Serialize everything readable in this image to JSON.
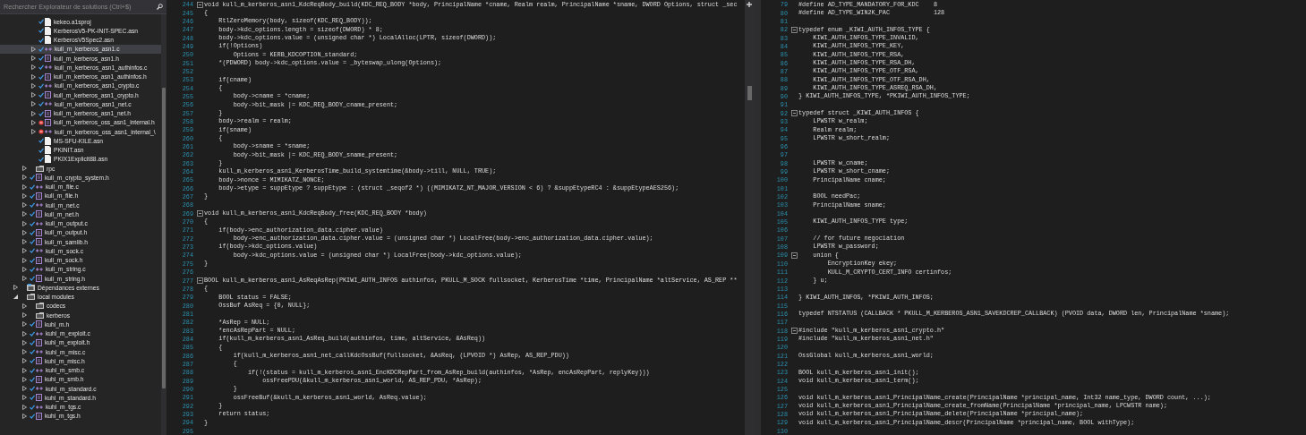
{
  "solution_explorer": {
    "search": {
      "placeholder": "Rechercher Explorateur de solutions (Ctrl+$)"
    },
    "tree": [
      {
        "children": [
          {
            "children": [
              {
                "label": "kekeo.a1sproj",
                "kind": "project",
                "checked": true,
                "error": false,
                "selected": false
              },
              {
                "label": "KerberosV5-PK-INIT-SPEC.asn",
                "kind": "asn",
                "checked": true,
                "error": false,
                "selected": false
              },
              {
                "label": "KerberosV5Spec2.asn",
                "kind": "asn",
                "checked": true,
                "error": false,
                "selected": false
              },
              {
                "label": "kull_m_kerberos_asn1.c",
                "kind": "c",
                "checked": true,
                "error": false,
                "expanded": false,
                "selected": true
              },
              {
                "label": "kull_m_kerberos_asn1.h",
                "kind": "h",
                "checked": true,
                "error": false,
                "expanded": false,
                "selected": false
              },
              {
                "label": "kull_m_kerberos_asn1_authinfos.c",
                "kind": "c",
                "checked": true,
                "error": false,
                "expanded": false,
                "selected": false
              },
              {
                "label": "kull_m_kerberos_asn1_authinfos.h",
                "kind": "h",
                "checked": true,
                "error": false,
                "expanded": false,
                "selected": false
              },
              {
                "label": "kull_m_kerberos_asn1_crypto.c",
                "kind": "c",
                "checked": true,
                "error": false,
                "expanded": false,
                "selected": false
              },
              {
                "label": "kull_m_kerberos_asn1_crypto.h",
                "kind": "h",
                "checked": true,
                "error": false,
                "expanded": false,
                "selected": false
              },
              {
                "label": "kull_m_kerberos_asn1_net.c",
                "kind": "c",
                "checked": true,
                "error": false,
                "expanded": false,
                "selected": false
              },
              {
                "label": "kull_m_kerberos_asn1_net.h",
                "kind": "h",
                "checked": true,
                "error": false,
                "expanded": false,
                "selected": false
              },
              {
                "label": "kull_m_kerberos_oss_asn1_internal.h",
                "kind": "h",
                "checked": false,
                "error": true,
                "expanded": false,
                "selected": false
              },
              {
                "label": "kull_m_kerberos_oss_asn1_internal_\\",
                "kind": "c",
                "checked": false,
                "error": true,
                "expanded": false,
                "selected": false
              },
              {
                "label": "MS-SFU-KILE.asn",
                "kind": "asn",
                "checked": true,
                "error": false,
                "selected": false
              },
              {
                "label": "PKINIT.asn",
                "kind": "asn",
                "checked": true,
                "error": false,
                "selected": false
              },
              {
                "label": "PKIX1Explicit88.asn",
                "kind": "asn",
                "checked": true,
                "error": false,
                "selected": false
              }
            ]
          },
          {
            "label": "rpc",
            "kind": "folder",
            "checked": false,
            "error": false,
            "expanded": false,
            "selected": false
          },
          {
            "label": "kull_m_crypto_system.h",
            "kind": "h",
            "checked": true,
            "error": false,
            "expanded": false,
            "selected": false
          },
          {
            "label": "kull_m_file.c",
            "kind": "c",
            "checked": true,
            "error": false,
            "expanded": false,
            "selected": false
          },
          {
            "label": "kull_m_file.h",
            "kind": "h",
            "checked": true,
            "error": false,
            "expanded": false,
            "selected": false
          },
          {
            "label": "kull_m_net.c",
            "kind": "c",
            "checked": true,
            "error": false,
            "expanded": false,
            "selected": false
          },
          {
            "label": "kull_m_net.h",
            "kind": "h",
            "checked": true,
            "error": false,
            "expanded": false,
            "selected": false
          },
          {
            "label": "kull_m_output.c",
            "kind": "c",
            "checked": true,
            "error": false,
            "expanded": false,
            "selected": false
          },
          {
            "label": "kull_m_output.h",
            "kind": "h",
            "checked": true,
            "error": false,
            "expanded": false,
            "selected": false
          },
          {
            "label": "kull_m_samlib.h",
            "kind": "h",
            "checked": true,
            "error": false,
            "expanded": false,
            "selected": false
          },
          {
            "label": "kull_m_sock.c",
            "kind": "c",
            "checked": true,
            "error": false,
            "expanded": false,
            "selected": false
          },
          {
            "label": "kull_m_sock.h",
            "kind": "h",
            "checked": true,
            "error": false,
            "expanded": false,
            "selected": false
          },
          {
            "label": "kull_m_string.c",
            "kind": "c",
            "checked": true,
            "error": false,
            "expanded": false,
            "selected": false
          },
          {
            "label": "kull_m_string.h",
            "kind": "h",
            "checked": true,
            "error": false,
            "expanded": false,
            "selected": false
          }
        ]
      },
      {
        "label": "Dépendances externes",
        "kind": "references",
        "checked": false,
        "error": false,
        "expanded": false,
        "selected": false
      },
      {
        "label": "local modules",
        "kind": "folder",
        "checked": false,
        "error": false,
        "expanded": true,
        "selected": false,
        "children": [
          {
            "label": "codecs",
            "kind": "folder",
            "checked": false,
            "error": false,
            "expanded": false,
            "selected": false
          },
          {
            "label": "kerberos",
            "kind": "folder",
            "checked": false,
            "error": false,
            "expanded": false,
            "selected": false
          },
          {
            "label": "kuhl_m.h",
            "kind": "h",
            "checked": true,
            "error": false,
            "expanded": false,
            "selected": false
          },
          {
            "label": "kuhl_m_exploit.c",
            "kind": "c",
            "checked": true,
            "error": false,
            "expanded": false,
            "selected": false
          },
          {
            "label": "kuhl_m_exploit.h",
            "kind": "h",
            "checked": true,
            "error": false,
            "expanded": false,
            "selected": false
          },
          {
            "label": "kuhl_m_misc.c",
            "kind": "c",
            "checked": true,
            "error": false,
            "expanded": false,
            "selected": false
          },
          {
            "label": "kuhl_m_misc.h",
            "kind": "h",
            "checked": true,
            "error": false,
            "expanded": false,
            "selected": false
          },
          {
            "label": "kuhl_m_smb.c",
            "kind": "c",
            "checked": true,
            "error": false,
            "expanded": false,
            "selected": false
          },
          {
            "label": "kuhl_m_smb.h",
            "kind": "h",
            "checked": true,
            "error": false,
            "expanded": false,
            "selected": false
          },
          {
            "label": "kuhl_m_standard.c",
            "kind": "c",
            "checked": true,
            "error": false,
            "expanded": false,
            "selected": false
          },
          {
            "label": "kuhl_m_standard.h",
            "kind": "h",
            "checked": true,
            "error": false,
            "expanded": false,
            "selected": false
          },
          {
            "label": "kuhl_m_tgs.c",
            "kind": "c",
            "checked": true,
            "error": false,
            "expanded": false,
            "selected": false
          },
          {
            "label": "kuhl_m_tgs.h",
            "kind": "h",
            "checked": true,
            "error": false,
            "expanded": false,
            "selected": false
          }
        ]
      }
    ]
  },
  "editors": [
    {
      "vertical_scrollbar": true,
      "lines": [
        {
          "n": "244",
          "text": "void kull_m_kerberos_asn1_KdcReqBody_build(KDC_REQ_BODY *body, PrincipalName *cname, Realm realm, PrincipalName *sname, DWORD Options, struct _sec",
          "fold": true
        },
        {
          "n": "245",
          "text": "{",
          "fold": false
        },
        {
          "n": "246",
          "text": "    RtlZeroMemory(body, sizeof(KDC_REQ_BODY));",
          "fold": false
        },
        {
          "n": "247",
          "text": "    body->kdc_options.length = sizeof(DWORD) * 8;",
          "fold": false
        },
        {
          "n": "248",
          "text": "    body->kdc_options.value = (unsigned char *) LocalAlloc(LPTR, sizeof(DWORD));",
          "fold": false
        },
        {
          "n": "249",
          "text": "    if(!Options)",
          "fold": false
        },
        {
          "n": "250",
          "text": "        Options = KERB_KDCOPTION_standard;",
          "fold": false
        },
        {
          "n": "251",
          "text": "    *(PDWORD) body->kdc_options.value = _byteswap_ulong(Options);",
          "fold": false
        },
        {
          "n": "252",
          "fold": false
        },
        {
          "n": "253",
          "text": "    if(cname)",
          "fold": false
        },
        {
          "n": "254",
          "text": "    {",
          "fold": false
        },
        {
          "n": "255",
          "text": "        body->cname = *cname;",
          "fold": false
        },
        {
          "n": "256",
          "text": "        body->bit_mask |= KDC_REQ_BODY_cname_present;",
          "fold": false
        },
        {
          "n": "257",
          "text": "    }",
          "fold": false
        },
        {
          "n": "258",
          "text": "    body->realm = realm;",
          "fold": false
        },
        {
          "n": "259",
          "text": "    if(sname)",
          "fold": false
        },
        {
          "n": "260",
          "text": "    {",
          "fold": false
        },
        {
          "n": "261",
          "text": "        body->sname = *sname;",
          "fold": false
        },
        {
          "n": "262",
          "text": "        body->bit_mask |= KDC_REQ_BODY_sname_present;",
          "fold": false
        },
        {
          "n": "263",
          "text": "    }",
          "fold": false
        },
        {
          "n": "264",
          "text": "    kull_m_kerberos_asn1_KerberosTime_build_systemtime(&body->till, NULL, TRUE);",
          "fold": false
        },
        {
          "n": "265",
          "text": "    body->nonce = MIMIKATZ_NONCE;",
          "fold": false
        },
        {
          "n": "266",
          "text": "    body->etype = suppEtype ? suppEtype : (struct _seqof2 *) ((MIMIKATZ_NT_MAJOR_VERSION < 6) ? &suppEtypeRC4 : &suppEtypeAES256);",
          "fold": false
        },
        {
          "n": "267",
          "text": "}",
          "fold": false
        },
        {
          "n": "268",
          "fold": false
        },
        {
          "n": "269",
          "text": "void kull_m_kerberos_asn1_KdcReqBody_free(KDC_REQ_BODY *body)",
          "fold": true
        },
        {
          "n": "270",
          "text": "{",
          "fold": false
        },
        {
          "n": "271",
          "text": "    if(body->enc_authorization_data.cipher.value)",
          "fold": false
        },
        {
          "n": "272",
          "text": "        body->enc_authorization_data.cipher.value = (unsigned char *) LocalFree(body->enc_authorization_data.cipher.value);",
          "fold": false
        },
        {
          "n": "273",
          "text": "    if(body->kdc_options.value)",
          "fold": false
        },
        {
          "n": "274",
          "text": "        body->kdc_options.value = (unsigned char *) LocalFree(body->kdc_options.value);",
          "fold": false
        },
        {
          "n": "275",
          "text": "}",
          "fold": false
        },
        {
          "n": "276",
          "fold": false
        },
        {
          "n": "277",
          "text": "BOOL kull_m_kerberos_asn1_AsReqAsRep(PKIWI_AUTH_INFOS authinfos, PKULL_M_SOCK fullsocket, KerberosTime *time, PrincipalName *altService, AS_REP **",
          "fold": true
        },
        {
          "n": "278",
          "text": "{",
          "fold": false
        },
        {
          "n": "279",
          "text": "    BOOL status = FALSE;",
          "fold": false
        },
        {
          "n": "280",
          "text": "    OssBuf AsReq = {0, NULL};",
          "fold": false
        },
        {
          "n": "281",
          "fold": false
        },
        {
          "n": "282",
          "text": "    *AsRep = NULL;",
          "fold": false
        },
        {
          "n": "283",
          "text": "    *encAsRepPart = NULL;",
          "fold": false
        },
        {
          "n": "284",
          "text": "    if(kull_m_kerberos_asn1_AsReq_build(authinfos, time, altService, &AsReq))",
          "fold": false
        },
        {
          "n": "285",
          "text": "    {",
          "fold": false
        },
        {
          "n": "286",
          "text": "        if(kull_m_kerberos_asn1_net_callKdcOssBuf(fullsocket, &AsReq, (LPVOID *) AsRep, AS_REP_PDU))",
          "fold": false
        },
        {
          "n": "287",
          "text": "        {",
          "fold": false
        },
        {
          "n": "288",
          "text": "            if(!(status = kull_m_kerberos_asn1_EncKDCRepPart_from_AsRep_build(authinfos, *AsRep, encAsRepPart, replyKey)))",
          "fold": false
        },
        {
          "n": "289",
          "text": "                ossFreePDU(&kull_m_kerberos_asn1_world, AS_REP_PDU, *AsRep);",
          "fold": false
        },
        {
          "n": "290",
          "text": "        }",
          "fold": false
        },
        {
          "n": "291",
          "text": "        ossFreeBuf(&kull_m_kerberos_asn1_world, AsReq.value);",
          "fold": false
        },
        {
          "n": "292",
          "text": "    }",
          "fold": false
        },
        {
          "n": "293",
          "text": "    return status;",
          "fold": false
        },
        {
          "n": "294",
          "text": "}",
          "fold": false
        },
        {
          "n": "295",
          "fold": false
        }
      ]
    },
    {
      "vertical_scrollbar": false,
      "lines": [
        {
          "n": "79",
          "text": "#define AD_TYPE_MANDATORY_FOR_KDC    8",
          "fold": false
        },
        {
          "n": "80",
          "text": "#define AD_TYPE_WIN2K_PAC            128",
          "fold": false
        },
        {
          "n": "81",
          "fold": false
        },
        {
          "n": "82",
          "text": "typedef enum _KIWI_AUTH_INFOS_TYPE {",
          "fold": true
        },
        {
          "n": "83",
          "text": "    KIWI_AUTH_INFOS_TYPE_INVALID,",
          "fold": false
        },
        {
          "n": "84",
          "text": "    KIWI_AUTH_INFOS_TYPE_KEY,",
          "fold": false
        },
        {
          "n": "85",
          "text": "    KIWI_AUTH_INFOS_TYPE_RSA,",
          "fold": false
        },
        {
          "n": "86",
          "text": "    KIWI_AUTH_INFOS_TYPE_RSA_DH,",
          "fold": false
        },
        {
          "n": "87",
          "text": "    KIWI_AUTH_INFOS_TYPE_OTF_RSA,",
          "fold": false
        },
        {
          "n": "88",
          "text": "    KIWI_AUTH_INFOS_TYPE_OTF_RSA_DH,",
          "fold": false
        },
        {
          "n": "89",
          "text": "    KIWI_AUTH_INFOS_TYPE_ASREQ_RSA_DH,",
          "fold": false
        },
        {
          "n": "90",
          "text": "} KIWI_AUTH_INFOS_TYPE, *PKIWI_AUTH_INFOS_TYPE;",
          "fold": false
        },
        {
          "n": "91",
          "fold": false
        },
        {
          "n": "92",
          "text": "typedef struct _KIWI_AUTH_INFOS {",
          "fold": true
        },
        {
          "n": "93",
          "text": "    LPWSTR w_realm;",
          "fold": false
        },
        {
          "n": "94",
          "text": "    Realm realm;",
          "fold": false
        },
        {
          "n": "95",
          "text": "    LPWSTR w_short_realm;",
          "fold": false
        },
        {
          "n": "96",
          "fold": false
        },
        {
          "n": "97",
          "fold": false
        },
        {
          "n": "98",
          "text": "    LPWSTR w_cname;",
          "fold": false
        },
        {
          "n": "99",
          "text": "    LPWSTR w_short_cname;",
          "fold": false
        },
        {
          "n": "100",
          "text": "    PrincipalName cname;",
          "fold": false
        },
        {
          "n": "101",
          "fold": false
        },
        {
          "n": "102",
          "text": "    BOOL needPac;",
          "fold": false
        },
        {
          "n": "103",
          "text": "    PrincipalName sname;",
          "fold": false
        },
        {
          "n": "104",
          "fold": false
        },
        {
          "n": "105",
          "text": "    KIWI_AUTH_INFOS_TYPE type;",
          "fold": false
        },
        {
          "n": "106",
          "fold": false
        },
        {
          "n": "107",
          "text": "    // for future negociation",
          "fold": false
        },
        {
          "n": "108",
          "text": "    LPWSTR w_password;",
          "fold": false
        },
        {
          "n": "109",
          "text": "    union {",
          "fold": true
        },
        {
          "n": "110",
          "text": "        EncryptionKey ekey;",
          "fold": false
        },
        {
          "n": "111",
          "text": "        KULL_M_CRYPTO_CERT_INFO certinfos;",
          "fold": false
        },
        {
          "n": "112",
          "text": "    } u;",
          "fold": false
        },
        {
          "n": "113",
          "fold": false
        },
        {
          "n": "114",
          "text": "} KIWI_AUTH_INFOS, *PKIWI_AUTH_INFOS;",
          "fold": false
        },
        {
          "n": "115",
          "fold": false
        },
        {
          "n": "116",
          "text": "typedef NTSTATUS (CALLBACK * PKULL_M_KERBEROS_ASN1_SAVEKDCREP_CALLBACK) (PVOID data, DWORD len, PrincipalName *sname);",
          "fold": false
        },
        {
          "n": "117",
          "fold": false
        },
        {
          "n": "118",
          "text": "#include \"kull_m_kerberos_asn1_crypto.h\"",
          "fold": true
        },
        {
          "n": "119",
          "text": "#include \"kull_m_kerberos_asn1_net.h\"",
          "fold": false
        },
        {
          "n": "120",
          "fold": false
        },
        {
          "n": "121",
          "text": "OssGlobal kull_m_kerberos_asn1_world;",
          "fold": false
        },
        {
          "n": "122",
          "fold": false
        },
        {
          "n": "123",
          "text": "BOOL kull_m_kerberos_asn1_init();",
          "fold": false
        },
        {
          "n": "124",
          "text": "void kull_m_kerberos_asn1_term();",
          "fold": false
        },
        {
          "n": "125",
          "fold": false
        },
        {
          "n": "126",
          "text": "void kull_m_kerberos_asn1_PrincipalName_create(PrincipalName *principal_name, Int32 name_type, DWORD count, ...);",
          "fold": false
        },
        {
          "n": "127",
          "text": "void kull_m_kerberos_asn1_PrincipalName_create_fromName(PrincipalName *principal_name, LPCWSTR name);",
          "fold": false
        },
        {
          "n": "128",
          "text": "void kull_m_kerberos_asn1_PrincipalName_delete(PrincipalName *principal_name);",
          "fold": false
        },
        {
          "n": "129",
          "text": "void kull_m_kerberos_asn1_PrincipalName_descr(PrincipalName *principal_name, BOOL withType);",
          "fold": false
        },
        {
          "n": "130",
          "fold": false
        }
      ]
    }
  ]
}
